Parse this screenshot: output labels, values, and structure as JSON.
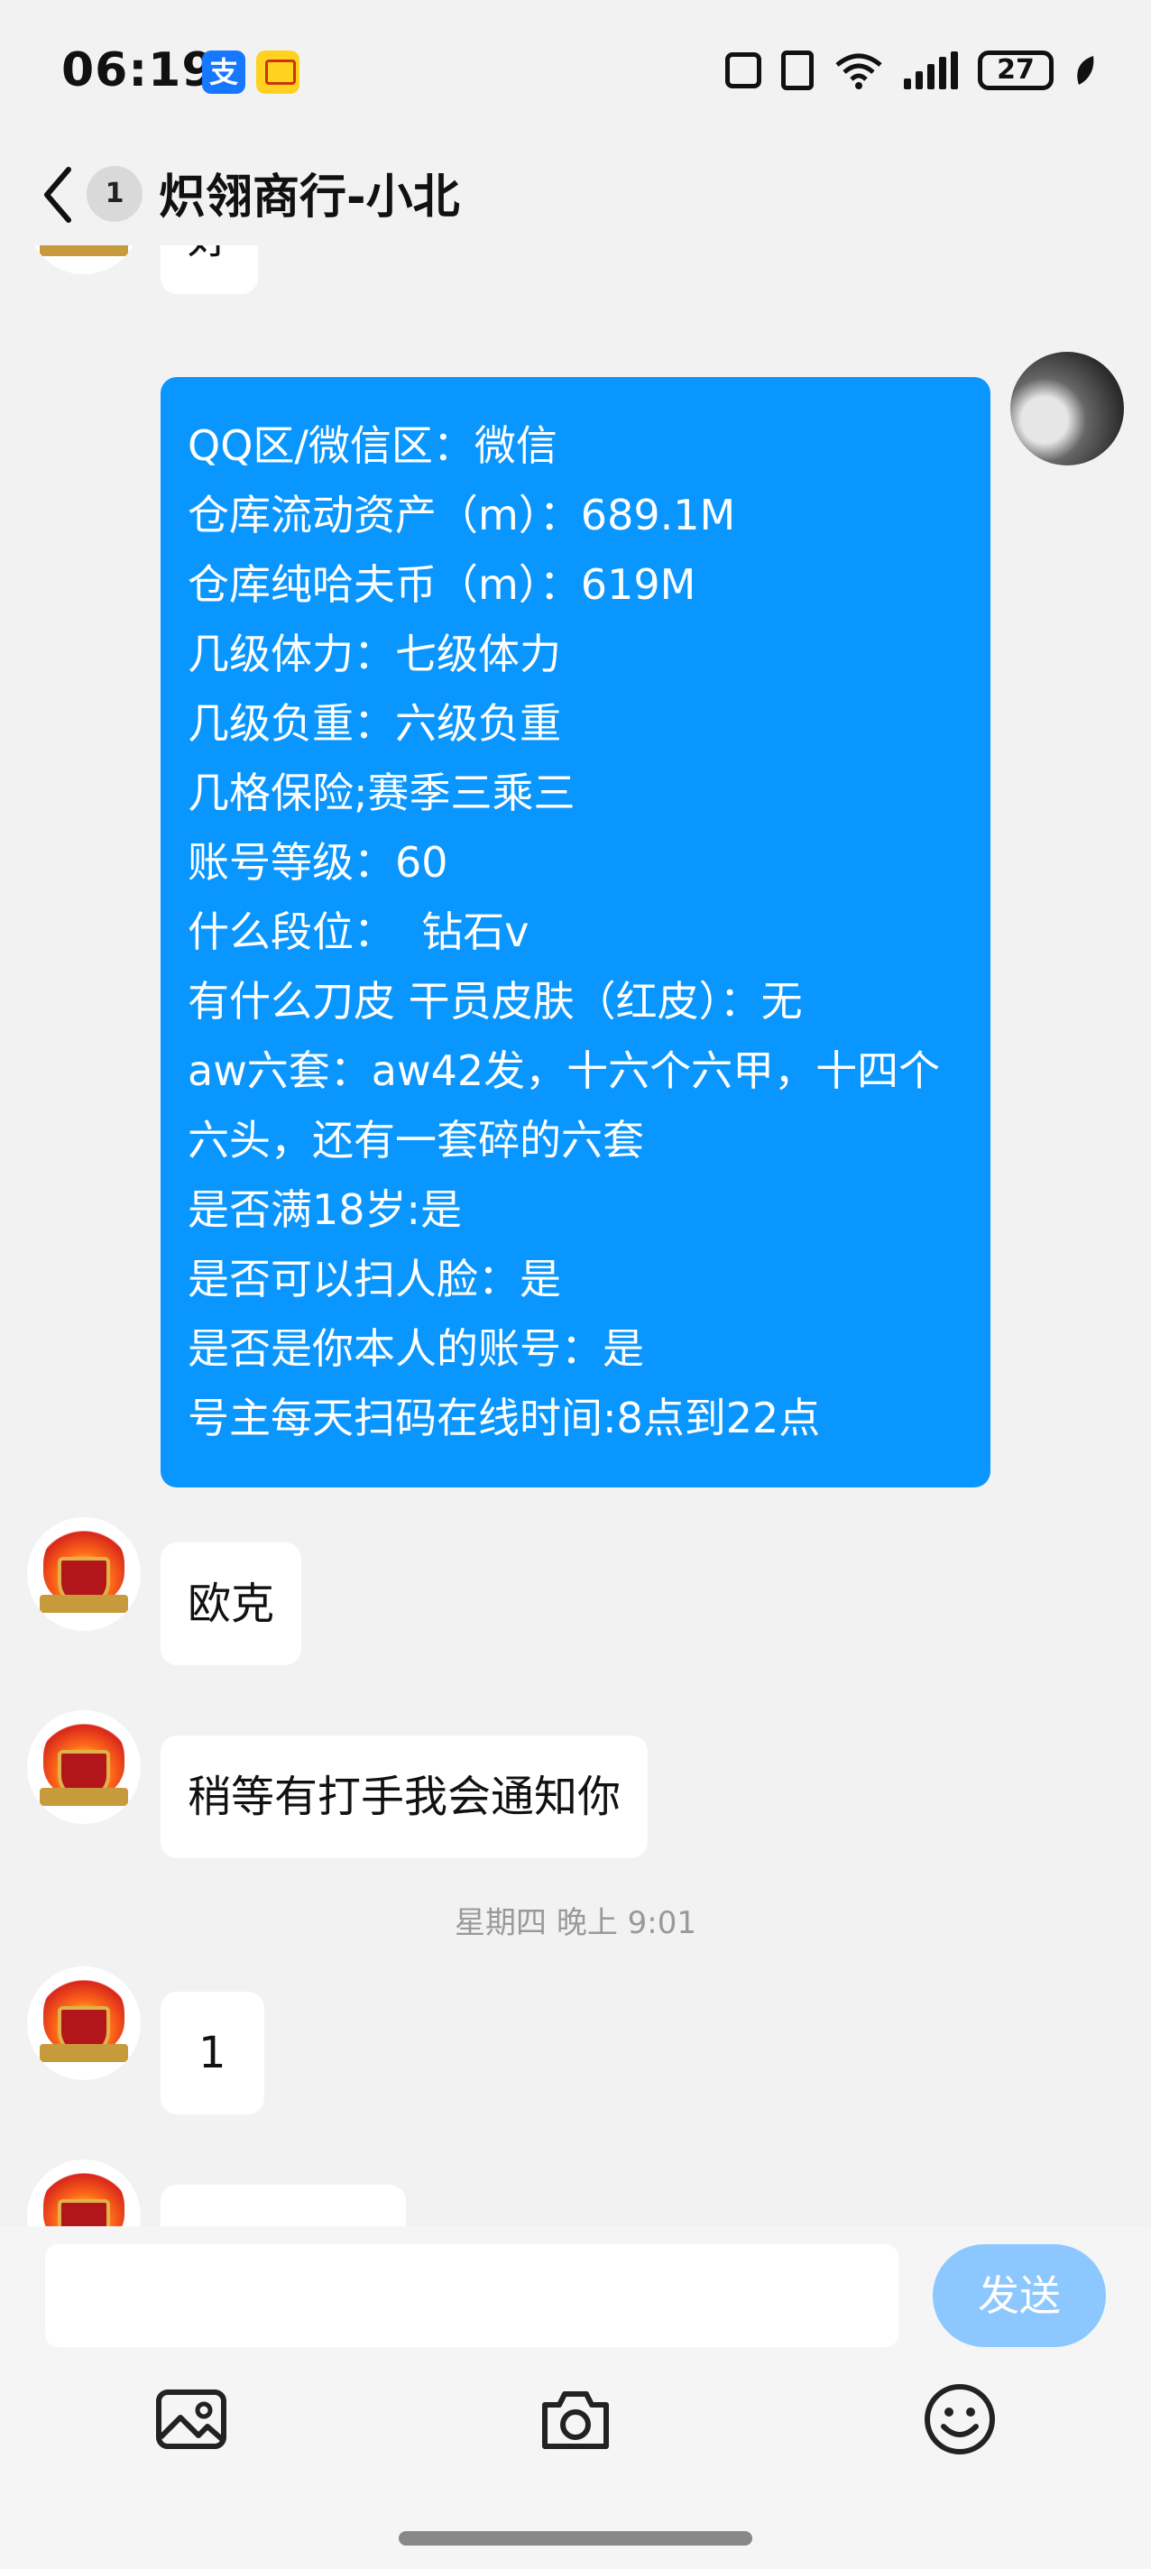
{
  "status_bar": {
    "time": "06:19",
    "battery": "27",
    "alipay_glyph": "支",
    "icons": [
      "alipay-icon",
      "app-badge-icon",
      "nfc-icon",
      "vibrate-icon",
      "wifi-icon",
      "signal-icon",
      "battery-icon",
      "eco-leaf-icon"
    ]
  },
  "header": {
    "back_icon": "chevron-left-icon",
    "unread_count": "1",
    "title": "炽翎商行-小北"
  },
  "messages": {
    "partial_top": "好",
    "outgoing_lines": [
      "QQ区/微信区：微信",
      "仓库流动资产（m）：689.1M",
      "仓库纯哈夫币（m）：619M",
      "几级体力：七级体力",
      "几级负重：六级负重",
      "几格保险;赛季三乘三",
      "账号等级：60",
      "什么段位：  钻石v",
      "有什么刀皮 干员皮肤（红皮）：无",
      "aw六套：aw42发，十六个六甲，十四个六头，还有一套碎的六套",
      "是否满18岁:是",
      "是否可以扫人脸：是",
      "是否是你本人的账号：是",
      "号主每天扫码在线时间:8点到22点"
    ],
    "reply_1": "欧克",
    "reply_2": "稍等有打手我会通知你",
    "timestamp": "星期四 晚上 9:01",
    "reply_3": "1"
  },
  "composer": {
    "input_placeholder": "",
    "send_label": "发送",
    "tools": [
      "image-icon",
      "camera-icon",
      "emoji-icon"
    ]
  },
  "colors": {
    "outgoing_bubble": "#0a96ff",
    "send_button": "#8cc8ff",
    "background": "#f2f2f2"
  }
}
